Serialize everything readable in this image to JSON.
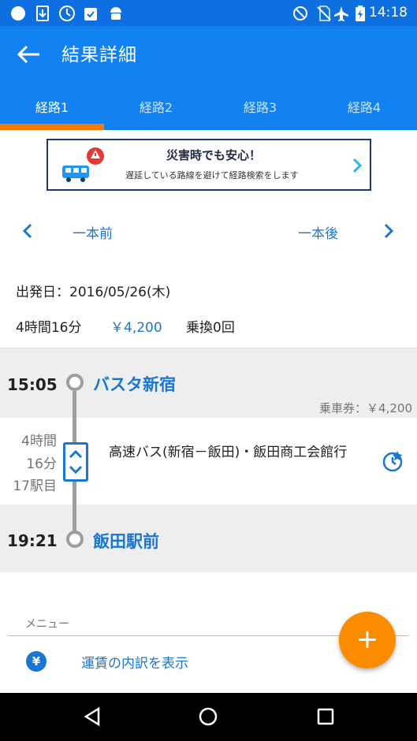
{
  "status_bar": {
    "time": "14:18",
    "icons": [
      "circle-icon",
      "download-icon",
      "clock-icon",
      "clipboard-check-icon",
      "android-icon",
      "do-not-disturb-icon",
      "no-sim-icon",
      "airplane-icon",
      "battery-charging-icon"
    ]
  },
  "header": {
    "title": "結果詳細",
    "tabs": [
      {
        "label": "経路1",
        "active": true
      },
      {
        "label": "経路2",
        "active": false
      },
      {
        "label": "経路3",
        "active": false
      },
      {
        "label": "経路4",
        "active": false
      }
    ]
  },
  "banner": {
    "title": "災害時でも安心！",
    "subtitle": "遅延している路線を避けて経路検索をします"
  },
  "navigation": {
    "prev_label": "一本前",
    "next_label": "一本後"
  },
  "summary": {
    "date": "出発日：2016/05/26(木)",
    "duration": "4時間16分",
    "fare": "￥4,200",
    "transfers": "乗換0回"
  },
  "route": {
    "departure": {
      "time": "15:05",
      "station": "バスタ新宿"
    },
    "ticket": "乗車券：￥4,200",
    "segment": {
      "duration_line1": "4時間",
      "duration_line2": "16分",
      "stops": "17駅目",
      "name": "高速バス(新宿－飯田)・飯田商工会館行"
    },
    "arrival": {
      "time": "19:21",
      "station": "飯田駅前"
    }
  },
  "menu": {
    "label": "メニュー",
    "items": [
      {
        "label": "運賃の内訳を表示",
        "icon": "yen-icon",
        "icon_text": "¥"
      }
    ]
  },
  "fab": {
    "label": "+"
  },
  "colors": {
    "primary": "#1282F3",
    "status": "#0D6FE0",
    "accent": "#F57C00",
    "link": "#1976D2"
  }
}
